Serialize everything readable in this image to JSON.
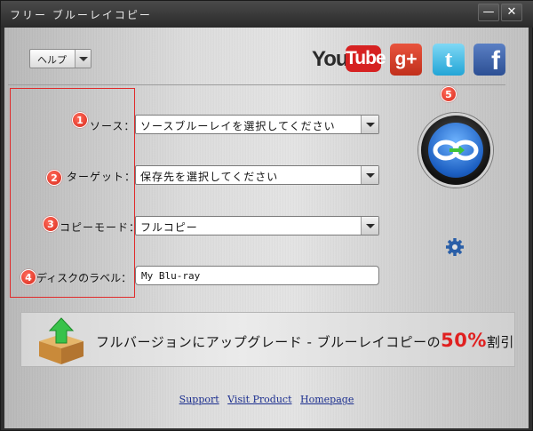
{
  "window": {
    "title": "フリー ブルーレイコピー",
    "minimize_label": "—",
    "close_label": "✕"
  },
  "help": {
    "label": "ヘルプ"
  },
  "social": {
    "youtube_you": "You",
    "youtube_tube": "Tube",
    "googleplus": "g+",
    "twitter": "t",
    "facebook": "f"
  },
  "steps": [
    "1",
    "2",
    "3",
    "4",
    "5"
  ],
  "form": {
    "source_label": "ソース：",
    "source_value": "ソースブルーレイを選択してください",
    "target_label": "ターゲット：",
    "target_value": "保存先を選択してください",
    "mode_label": "コピーモード：",
    "mode_value": "フルコピー",
    "disc_label": "ディスクのラベル：",
    "disc_value": "My Blu-ray"
  },
  "banner": {
    "text_before": "フルバージョンにアップグレード - ブルーレイコピーの",
    "discount": "50%",
    "text_after": "割引"
  },
  "links": {
    "support": "Support",
    "visit_product": "Visit Product",
    "homepage": "Homepage"
  },
  "colors": {
    "accent_red": "#e02b2b",
    "link": "#1c2f8f",
    "start_blue": "#1c5fc2"
  }
}
